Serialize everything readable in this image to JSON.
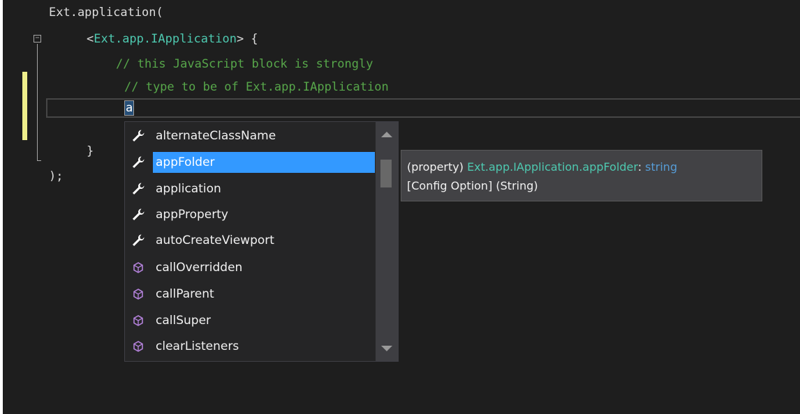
{
  "editor": {
    "lines": [
      {
        "parts": [
          {
            "text": "Ext.application(",
            "kind": "punct"
          }
        ]
      },
      {
        "parts": [
          {
            "text": "<",
            "kind": "punct"
          },
          {
            "text": "Ext.app.IApplication",
            "kind": "type"
          },
          {
            "text": "> {",
            "kind": "punct"
          }
        ]
      },
      {
        "parts": [
          {
            "text": "// this JavaScript block is strongly",
            "kind": "comment"
          }
        ]
      },
      {
        "parts": [
          {
            "text": "// type to be of Ext.app.IApplication",
            "kind": "comment"
          }
        ]
      },
      {
        "parts": [
          {
            "text": "a",
            "kind": "typed"
          }
        ]
      },
      {
        "parts": [
          {
            "text": "}",
            "kind": "punct"
          }
        ]
      },
      {
        "parts": [
          {
            "text": ");",
            "kind": "punct"
          }
        ]
      }
    ],
    "fold_glyph": "−"
  },
  "completion": {
    "items": [
      {
        "label": "alternateClassName",
        "icon": "wrench-icon",
        "selected": false
      },
      {
        "label": "appFolder",
        "icon": "wrench-icon",
        "selected": true
      },
      {
        "label": "application",
        "icon": "wrench-icon",
        "selected": false
      },
      {
        "label": "appProperty",
        "icon": "wrench-icon",
        "selected": false
      },
      {
        "label": "autoCreateViewport",
        "icon": "wrench-icon",
        "selected": false
      },
      {
        "label": "callOverridden",
        "icon": "method-cube-icon",
        "selected": false
      },
      {
        "label": "callParent",
        "icon": "method-cube-icon",
        "selected": false
      },
      {
        "label": "callSuper",
        "icon": "method-cube-icon",
        "selected": false
      },
      {
        "label": "clearListeners",
        "icon": "method-cube-icon",
        "selected": false
      }
    ]
  },
  "tooltip": {
    "kind": "(property) ",
    "qualified_name": "Ext.app.IApplication.appFolder",
    "separator": ": ",
    "type": "string",
    "description": "[Config Option] (String)"
  },
  "colors": {
    "background": "#1e1e1e",
    "comment": "#57a64a",
    "type": "#4ec9b0",
    "keyword": "#569cd6",
    "selection": "#3399ff",
    "change_marker": "#efef8c",
    "method_icon": "#b180d7"
  }
}
